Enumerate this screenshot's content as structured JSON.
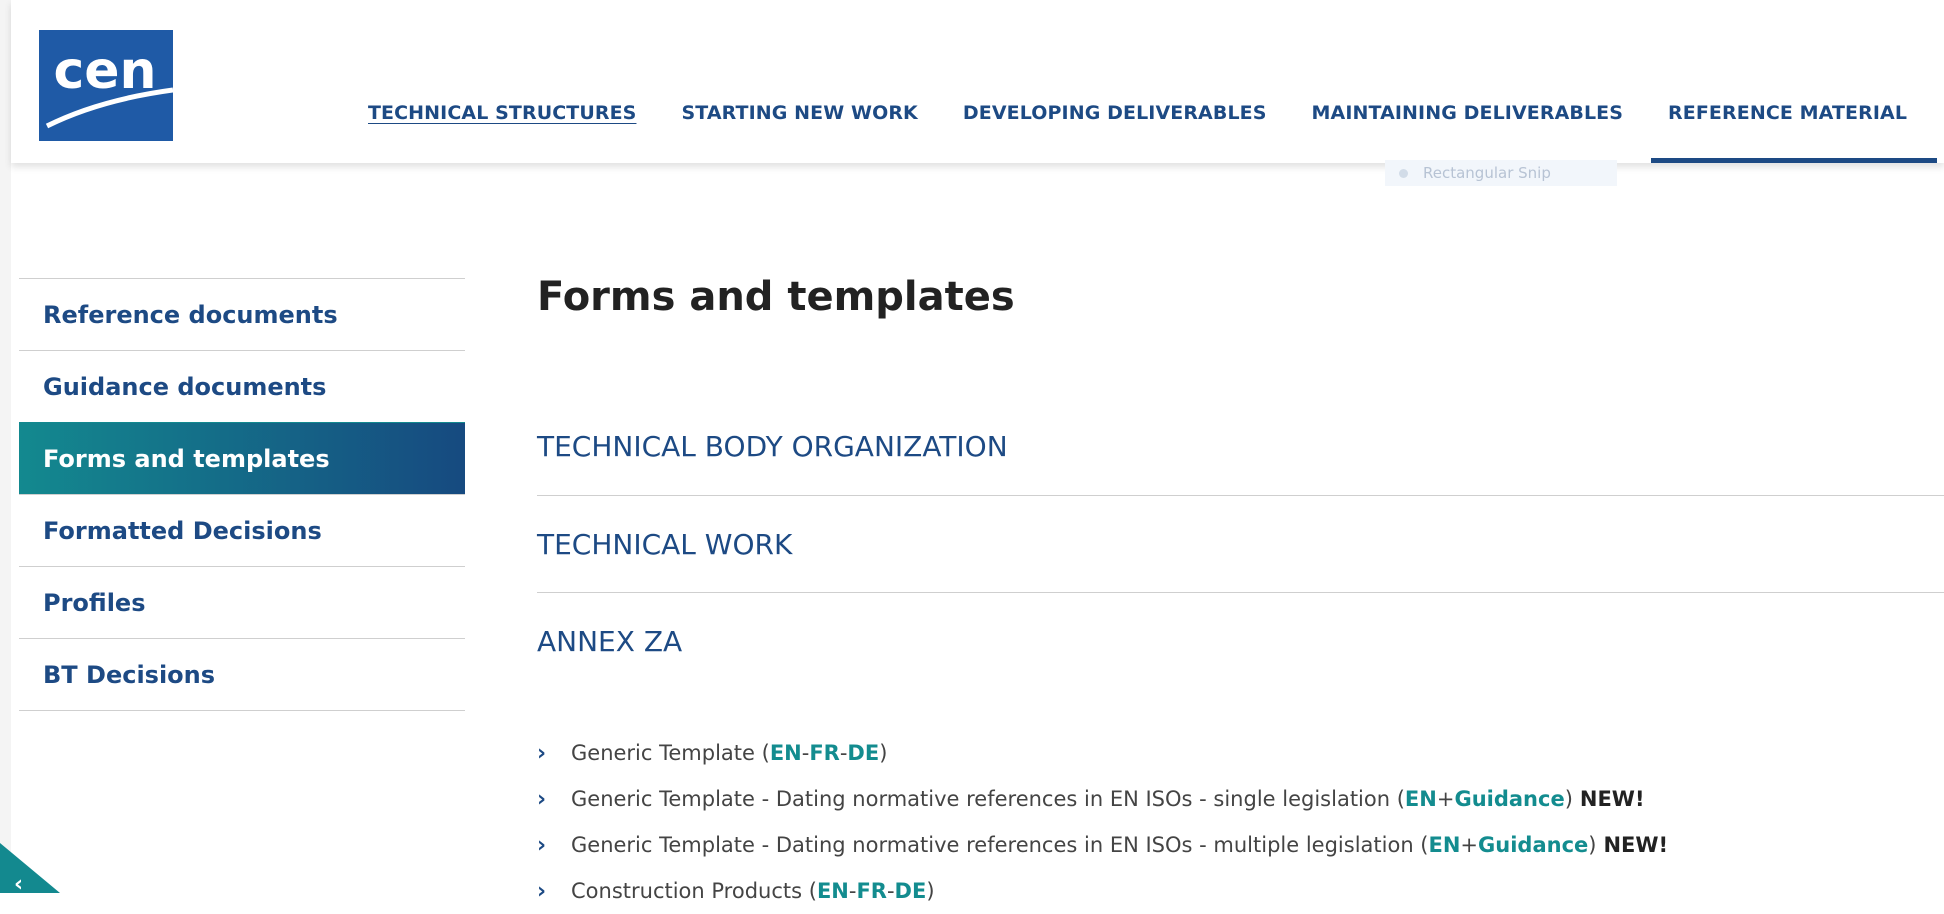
{
  "logo": {
    "text": "cen"
  },
  "nav": {
    "items": [
      {
        "label": "TECHNICAL STRUCTURES"
      },
      {
        "label": "STARTING NEW WORK"
      },
      {
        "label": "DEVELOPING DELIVERABLES"
      },
      {
        "label": "MAINTAINING DELIVERABLES"
      },
      {
        "label": "REFERENCE MATERIAL"
      }
    ],
    "active": "REFERENCE MATERIAL"
  },
  "ghost_popup": {
    "label": "Rectangular Snip"
  },
  "sidebar": {
    "items": [
      {
        "label": "Reference documents"
      },
      {
        "label": "Guidance documents"
      },
      {
        "label": "Forms and templates"
      },
      {
        "label": "Formatted Decisions"
      },
      {
        "label": "Profiles"
      },
      {
        "label": "BT Decisions"
      }
    ],
    "active": "Forms and templates"
  },
  "main": {
    "title": "Forms and templates",
    "sections": [
      {
        "label": "TECHNICAL BODY ORGANIZATION"
      },
      {
        "label": "TECHNICAL WORK"
      },
      {
        "label": "ANNEX ZA"
      }
    ],
    "documents": [
      {
        "text": "Generic Template (",
        "links": [
          "EN",
          "FR",
          "DE"
        ],
        "seps": [
          " - ",
          " - "
        ],
        "close": ")",
        "new": ""
      },
      {
        "text": "Generic Template - Dating normative references in EN ISOs - single legislation (",
        "links": [
          "EN",
          "Guidance"
        ],
        "seps": [
          " + "
        ],
        "close": ")",
        "new": "NEW!"
      },
      {
        "text": "Generic Template - Dating normative references in EN ISOs - multiple legislation (",
        "links": [
          "EN",
          "Guidance"
        ],
        "seps": [
          " +"
        ],
        "close": ")",
        "new": "NEW!"
      },
      {
        "text": "Construction Products (",
        "links": [
          "EN",
          "FR",
          "DE"
        ],
        "seps": [
          "- ",
          " - "
        ],
        "close": ")",
        "new": ""
      }
    ]
  },
  "colors": {
    "brand_blue": "#1d4a84",
    "teal": "#138c8f",
    "logo_blue": "#1f5aa6"
  }
}
